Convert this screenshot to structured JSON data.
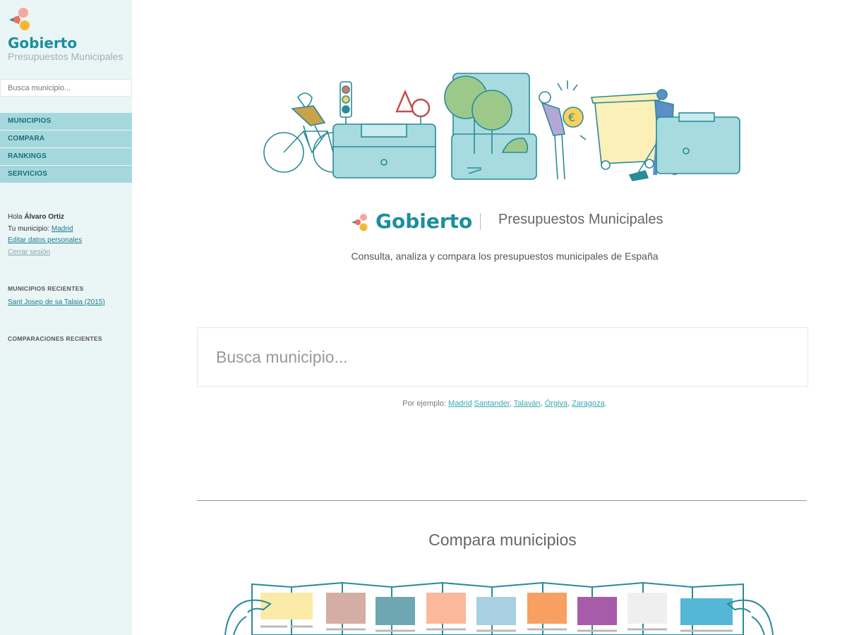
{
  "sidebar": {
    "brand_title": "Gobierto",
    "brand_subtitle": "Presupuestos Municipales",
    "search_placeholder": "Busca municipio...",
    "nav": [
      {
        "label": "MUNICIPIOS"
      },
      {
        "label": "COMPARA"
      },
      {
        "label": "RANKINGS"
      },
      {
        "label": "SERVICIOS"
      }
    ],
    "user": {
      "greeting": "Hola ",
      "name": "Álvaro Ortiz",
      "municipio_label": "Tu municipio: ",
      "municipio": "Madrid",
      "edit_link": "Editar datos personales",
      "logout_link": "Cerrar sesión"
    },
    "recent_municipios_title": "MUNICIPIOS RECIENTES",
    "recent_municipios": [
      "Sant Josep de sa Talaia (2015)"
    ],
    "recent_comparaciones_title": "COMPARACIONES RECIENTES"
  },
  "main": {
    "logo_text": "Gobierto",
    "logo_subtitle": "Presupuestos Municipales",
    "tagline": "Consulta, analiza y compara los presupuestos municipales de España",
    "search_placeholder": "Busca municipio...",
    "examples_prefix": "Por ejemplo: ",
    "examples": [
      "Madrid",
      "Santander",
      "Talaván",
      "Órgiva",
      "Zaragoza"
    ],
    "examples_suffix": ".",
    "compare_title": "Compara municipios"
  },
  "colors": {
    "brand": "#1a8f9c",
    "sidebar_bg": "#eaf5f6",
    "nav_bg": "#a5d8dd",
    "illustration_teal": "#a7dbe0",
    "logo_red": "#f26d5b",
    "logo_yellow": "#f7b733",
    "logo_pink": "#f4a9a0"
  }
}
